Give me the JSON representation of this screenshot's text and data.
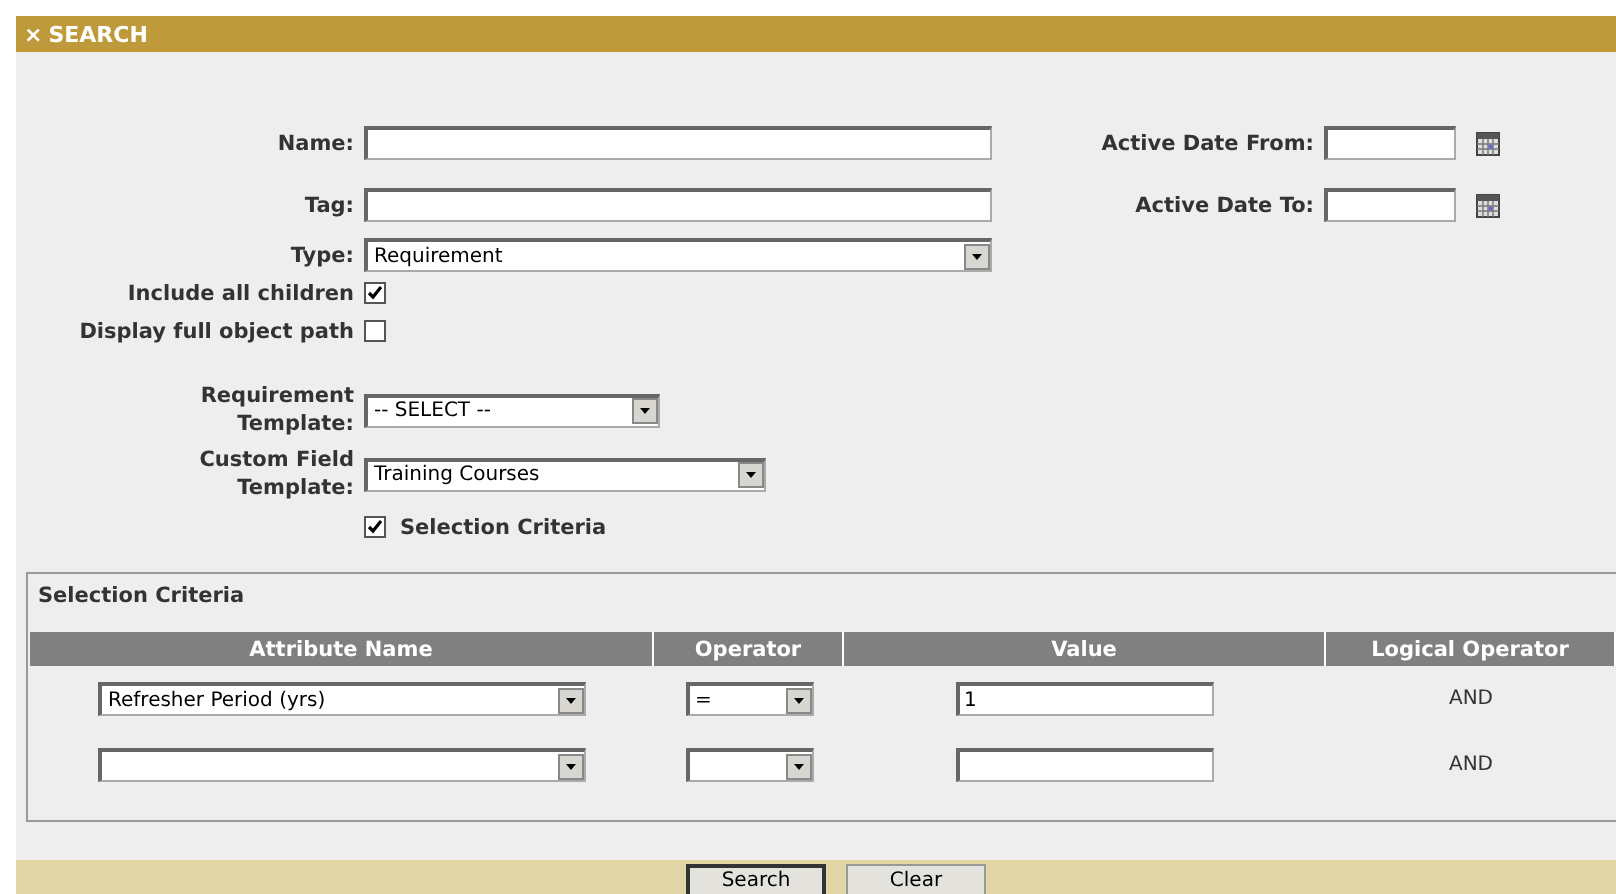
{
  "panel": {
    "close": "×",
    "title": "SEARCH"
  },
  "fields": [
    {
      "kind": "text",
      "label": "Name:"
    },
    {
      "kind": "text",
      "label": "Tag:"
    },
    {
      "kind": "select",
      "label": "Type:",
      "value": "Requirement"
    },
    {
      "kind": "checkbox",
      "label": "Include all children",
      "checked": true
    },
    {
      "kind": "checkbox",
      "label": "Display full object path",
      "checked": false
    },
    {
      "kind": "select",
      "label": "Requirement Template:",
      "value": "-- SELECT --"
    },
    {
      "kind": "select",
      "label": "Custom Field Template:",
      "value": "Training Courses"
    },
    {
      "kind": "toggle",
      "label": "Selection Criteria",
      "checked": true
    }
  ],
  "date_fields": [
    {
      "label": "Active Date From:"
    },
    {
      "label": "Active Date To:"
    }
  ],
  "criteria": {
    "title": "Selection Criteria",
    "columns": [
      "Attribute Name",
      "Operator",
      "Value",
      "Logical Operator"
    ],
    "rows": [
      {
        "attribute": "Refresher Period (yrs)",
        "operator": "=",
        "value": "1",
        "logical": "AND"
      },
      {
        "logical": "AND"
      }
    ]
  },
  "buttons": [
    {
      "label": "Search",
      "selected": true
    },
    {
      "label": "Clear",
      "selected": false
    }
  ]
}
